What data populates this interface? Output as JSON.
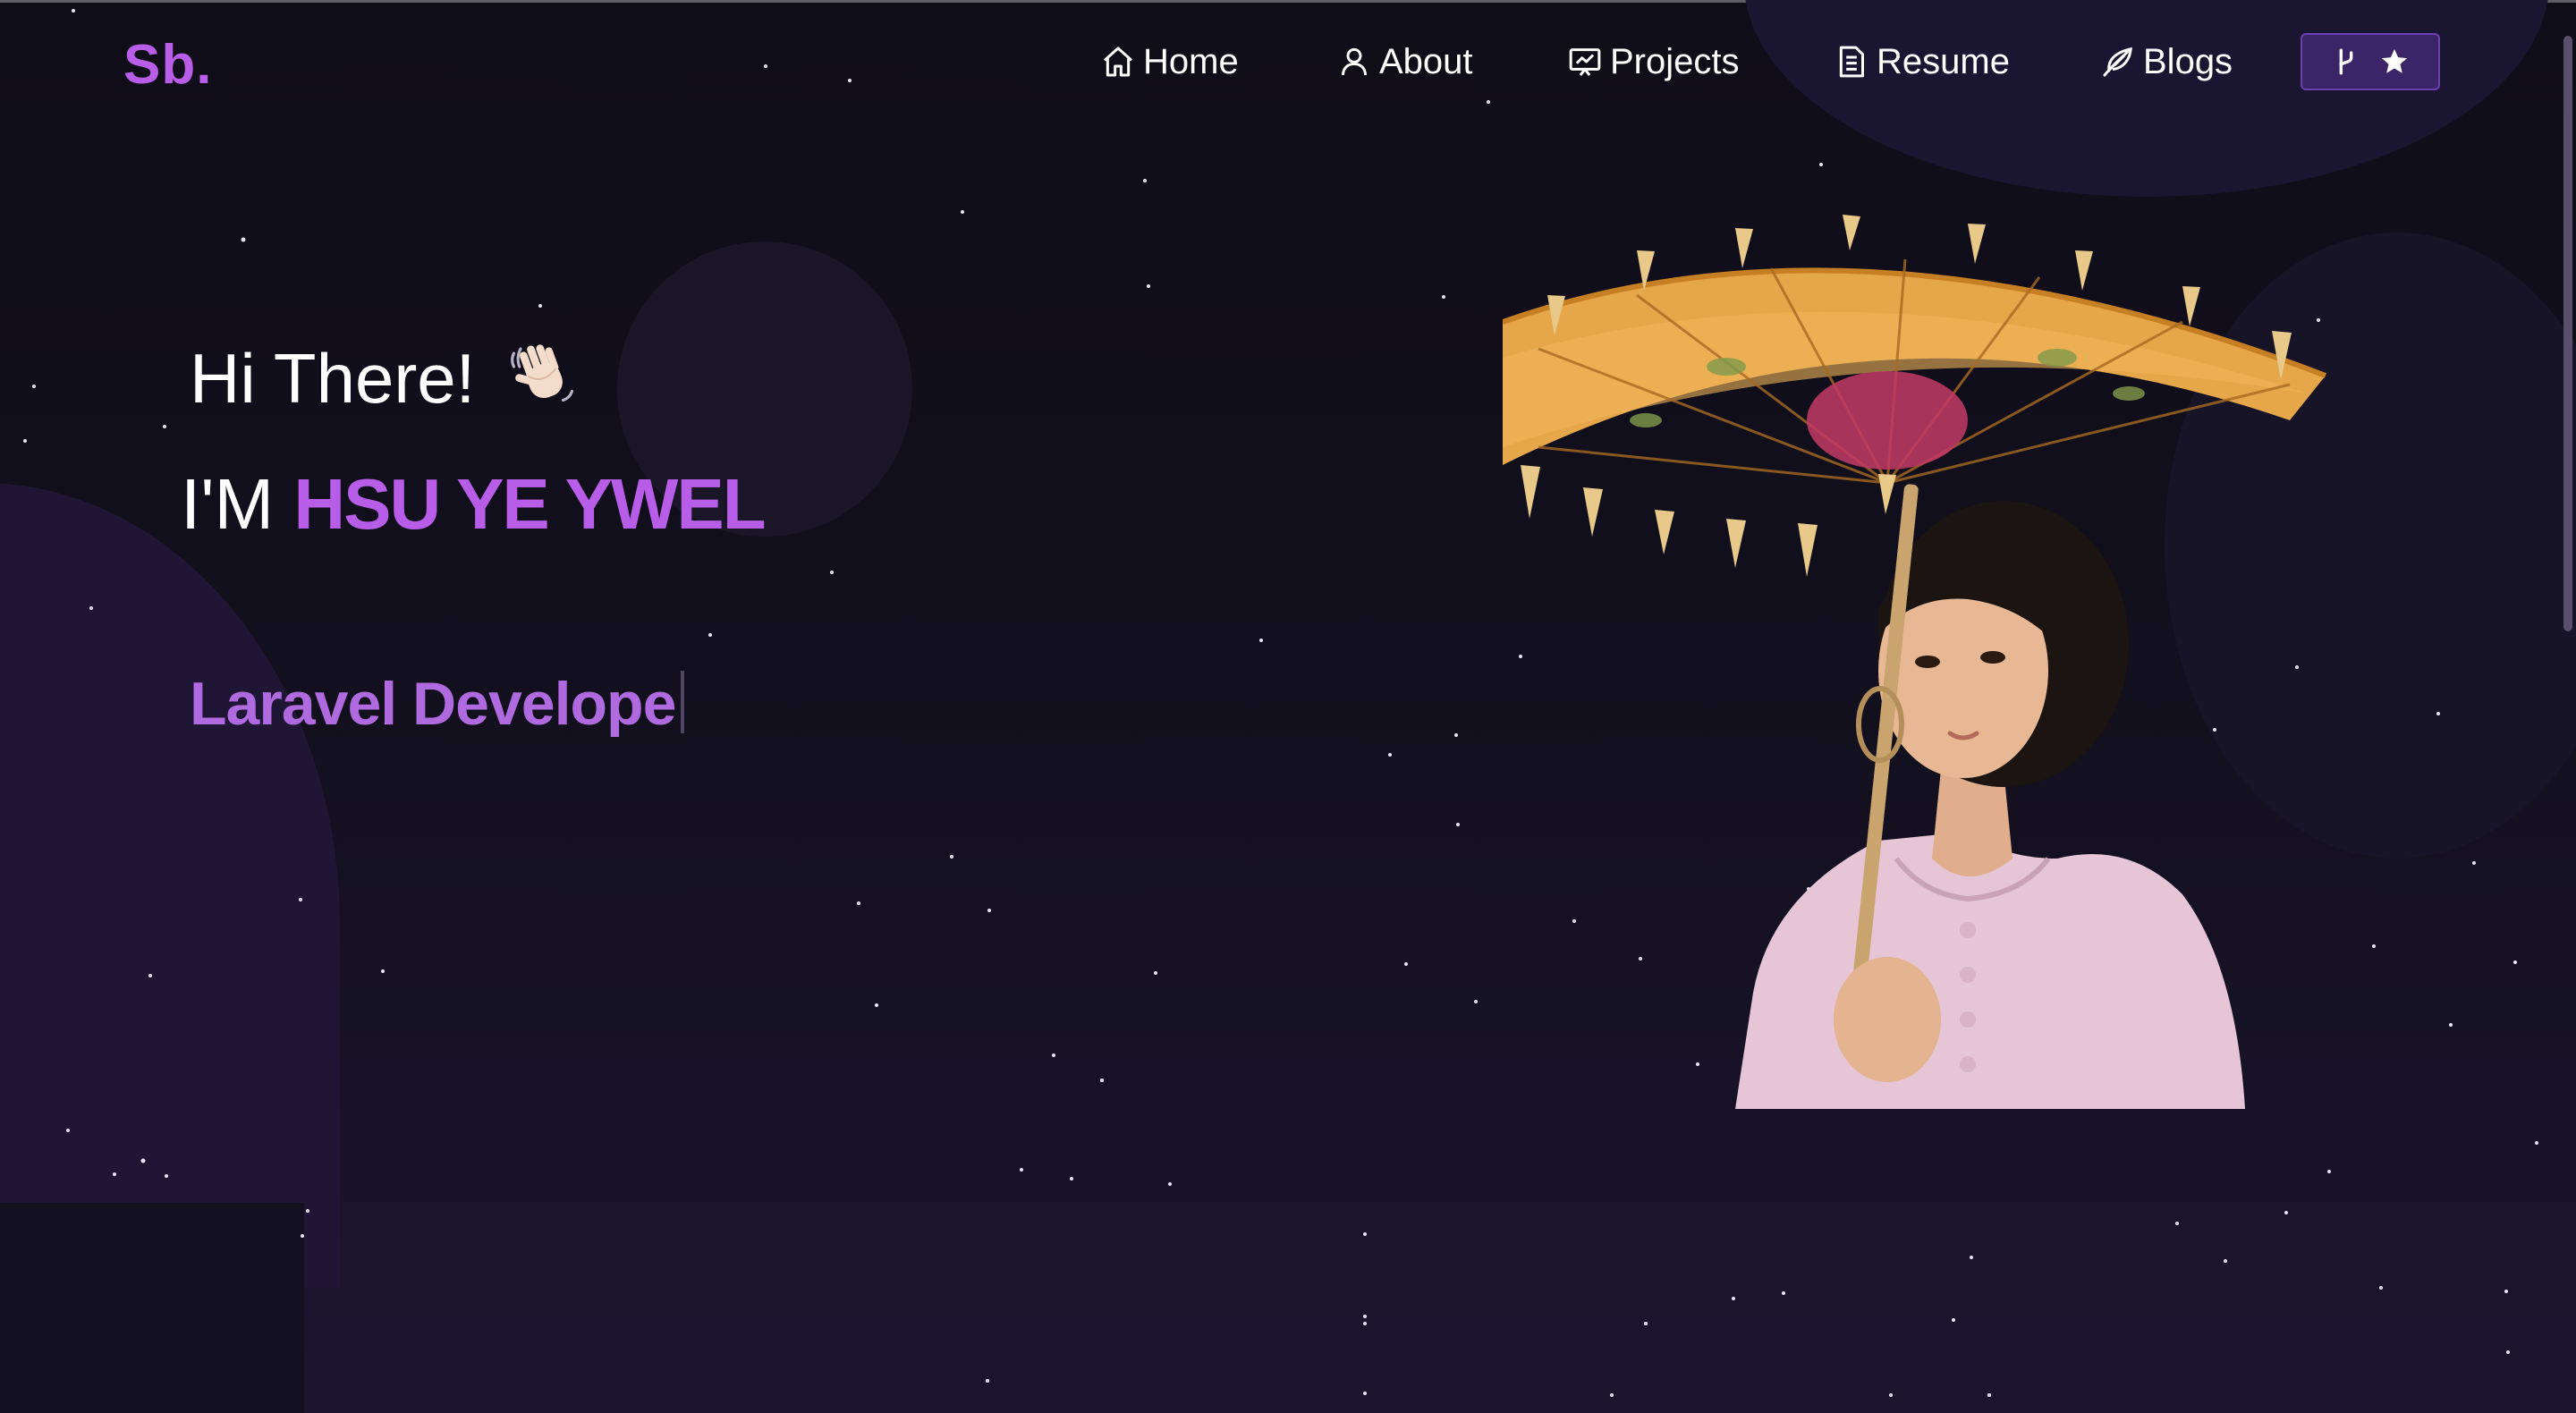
{
  "brand": {
    "logo": "Sb."
  },
  "nav": {
    "items": [
      {
        "label": "Home",
        "icon": "home-icon"
      },
      {
        "label": "About",
        "icon": "user-icon"
      },
      {
        "label": "Projects",
        "icon": "presentation-icon"
      },
      {
        "label": "Resume",
        "icon": "document-icon"
      },
      {
        "label": "Blogs",
        "icon": "feather-icon"
      }
    ],
    "github_button": {
      "icons": [
        "fork-icon",
        "star-icon"
      ]
    }
  },
  "hero": {
    "greeting": "Hi There!",
    "greeting_emoji": "waving-hand-icon",
    "intro_prefix": "I'M",
    "name": "HSU YE YWEL",
    "typed_text": "Laravel Develope"
  },
  "colors": {
    "accent": "#b85de8",
    "background": "#120f1d",
    "button_bg": "#3b2468"
  }
}
